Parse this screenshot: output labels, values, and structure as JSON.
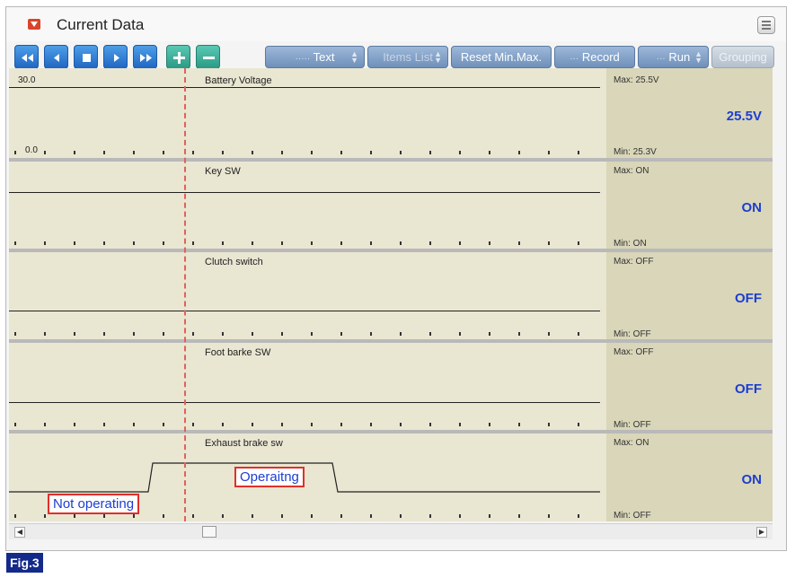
{
  "window": {
    "title": "Current Data",
    "title_icon": "dropdown-arrow-icon",
    "menu_icon": "menu-icon"
  },
  "toolbar": {
    "nav_buttons": [
      {
        "name": "rewind-button",
        "icon": "double-left-arrow-icon"
      },
      {
        "name": "back-button",
        "icon": "left-arrow-icon"
      },
      {
        "name": "stop-button",
        "icon": "stop-square-icon"
      },
      {
        "name": "play-button",
        "icon": "right-arrow-icon"
      },
      {
        "name": "fast-forward-button",
        "icon": "double-right-arrow-icon"
      },
      {
        "name": "zoom-in-button",
        "icon": "plus-icon"
      },
      {
        "name": "zoom-out-button",
        "icon": "minus-icon"
      }
    ],
    "text_label": "Text",
    "items_list_label": "Items List",
    "reset_label": "Reset Min.Max.",
    "record_label": "Record",
    "run_label": "Run",
    "grouping_label": "Grouping"
  },
  "lanes": [
    {
      "name": "Battery Voltage",
      "max": "Max: 25.5V",
      "min": "Min:  25.3V",
      "value": "25.5V",
      "ytop": "30.0",
      "ybottom": "0.0"
    },
    {
      "name": "Key SW",
      "max": "Max: ON",
      "min": "Min:  ON",
      "value": "ON"
    },
    {
      "name": "Clutch switch",
      "max": "Max: OFF",
      "min": "Min:  OFF",
      "value": "OFF"
    },
    {
      "name": "Foot barke SW",
      "max": "Max: OFF",
      "min": "Min:  OFF",
      "value": "OFF"
    },
    {
      "name": "Exhaust brake sw",
      "max": "Max: ON",
      "min": "Min:  OFF",
      "value": "ON"
    }
  ],
  "annotations": {
    "operating": "Operaitng",
    "not_operating": "Not operating"
  },
  "caption": "Fig.3",
  "colors": {
    "trace_background": "#e9e6d2",
    "value_panel": "#d9d6b9",
    "value_text": "#1d3ed1",
    "cursor": "#e0625a",
    "annotation_border": "#e0302a",
    "caption_bg": "#142a8a"
  }
}
